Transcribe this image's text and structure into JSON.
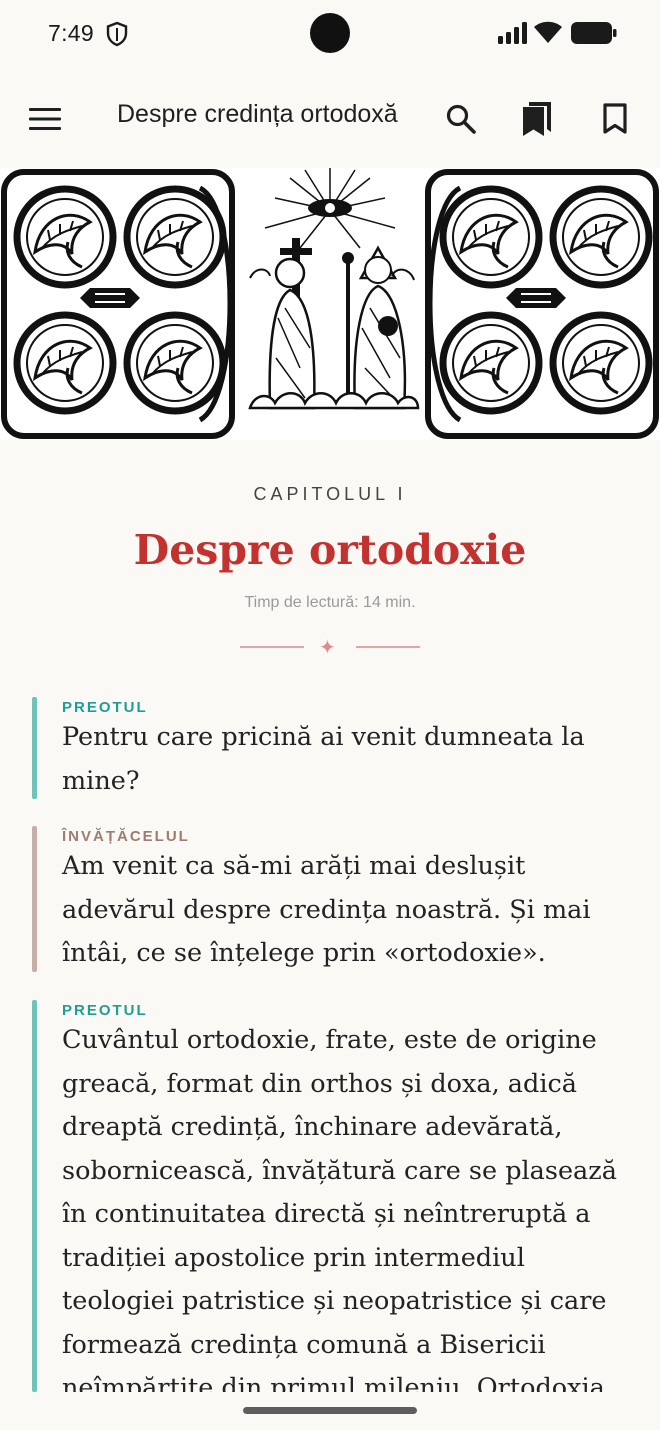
{
  "status_bar": {
    "time": "7:49"
  },
  "app_bar": {
    "title": "Despre credința ortodoxă"
  },
  "chapter": {
    "label": "CAPITOLUL I",
    "title": "Despre ortodoxie",
    "reading_time": "Timp de lectură: 14 min."
  },
  "dialog": [
    {
      "speaker": "PREOTUL",
      "text": "Pentru care pricină ai venit dumneata la mine?"
    },
    {
      "speaker": "ÎNVĂȚĂCELUL",
      "text": "Am venit ca să-mi arăți mai deslușit adevărul despre credința noastră. Și mai întâi, ce se înțelege prin «ortodoxie»."
    },
    {
      "speaker": "PREOTUL",
      "text": "Cuvântul ortodoxie, frate, este de origine greacă, format din orthos și doxa, adică dreaptă credință, închinare adevărată, sobornicească, învățătură care se plasează în continuitatea directă și neîntreruptă a tradiției apostolice prin intermediul teologiei patristice și neopatristice și care formează credința comună a Bisericii neîmpărțite din primul mileniu. Ortodoxia"
    }
  ],
  "colors": {
    "accent_red": "#c3322f",
    "priest_teal": "#1f9e92",
    "disciple_brown": "#9b7d72"
  },
  "icons": [
    "shield-icon",
    "signal-icon",
    "wifi-icon",
    "battery-icon",
    "menu-icon",
    "search-icon",
    "bookmarks-list-icon",
    "bookmark-icon"
  ]
}
